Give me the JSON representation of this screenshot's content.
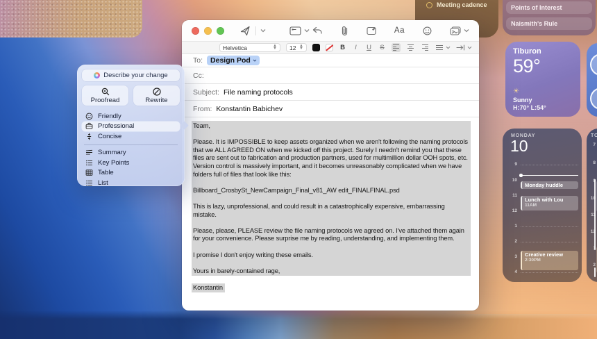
{
  "desktop_widgets": {
    "reminder_top": {
      "label": "Meeting cadence"
    },
    "notes_list": {
      "items": [
        "Points of Interest",
        "Naismith's Rule"
      ]
    },
    "weather": {
      "city": "Tiburon",
      "temp": "59°",
      "condition": "Sunny",
      "hi_lo": "H:70° L:54°",
      "sun_icon": "☀"
    },
    "calendar": {
      "day_name": "MONDAY",
      "day_number": "10",
      "hours": [
        "9",
        "10",
        "11",
        "12",
        "1",
        "2",
        "3",
        "4"
      ],
      "events": [
        {
          "title": "Monday huddle",
          "time": ""
        },
        {
          "title": "Lunch with Lou",
          "time": "11AM"
        },
        {
          "title": "Creative review",
          "time": "2:30PM"
        }
      ]
    },
    "calendar_partial": {
      "header": "TO",
      "hours": [
        "7",
        "8",
        "9",
        "10",
        "11",
        "12",
        "1",
        "2"
      ]
    }
  },
  "mail": {
    "toolbar": {
      "format_label": "Aa"
    },
    "format_bar": {
      "font": "Helvetica",
      "size": "12",
      "bold": "B",
      "italic": "I",
      "underline": "U",
      "strike": "S"
    },
    "fields": {
      "to_label": "To:",
      "to_value": "Design Pod",
      "cc_label": "Cc:",
      "subject_label": "Subject:",
      "subject_value": "File naming protocols",
      "from_label": "From:",
      "from_value": "Konstantin Babichev"
    },
    "body": {
      "paragraphs": [
        "Team,",
        "Please. It is IMPOSSIBLE to keep assets organized when we aren't following the naming protocols that we ALL AGREED ON when we kicked off this project. Surely I needn't remind you that these files are sent out to fabrication and production partners, used for multimillion dollar OOH spots, etc. Version control is massively important, and it becomes unreasonably complicated when we have folders full of files that look like this:",
        "Billboard_CrosbySt_NewCampaign_Final_v81_AW edit_FINALFINAL.psd",
        "This is lazy, unprofessional, and could result in a catastrophically expensive, embarrassing mistake.",
        "Please, please, PLEASE review the file naming protocols we agreed on. I've attached them again for your convenience. Please surprise me by reading, understanding, and implementing them.",
        "I promise I don't enjoy writing these emails.",
        "Yours in barely-contained rage,"
      ],
      "signature": "Konstantin"
    }
  },
  "writing_tools": {
    "describe_placeholder": "Describe your change",
    "proofread_label": "Proofread",
    "rewrite_label": "Rewrite",
    "tones": [
      "Friendly",
      "Professional",
      "Concise"
    ],
    "selected_tone": "Professional",
    "transforms": [
      "Summary",
      "Key Points",
      "Table",
      "List"
    ]
  },
  "colors": {
    "accent_token": "#b9d2f7",
    "selection": "#d5d5d5",
    "popup_tint": "#ccd5ee"
  }
}
